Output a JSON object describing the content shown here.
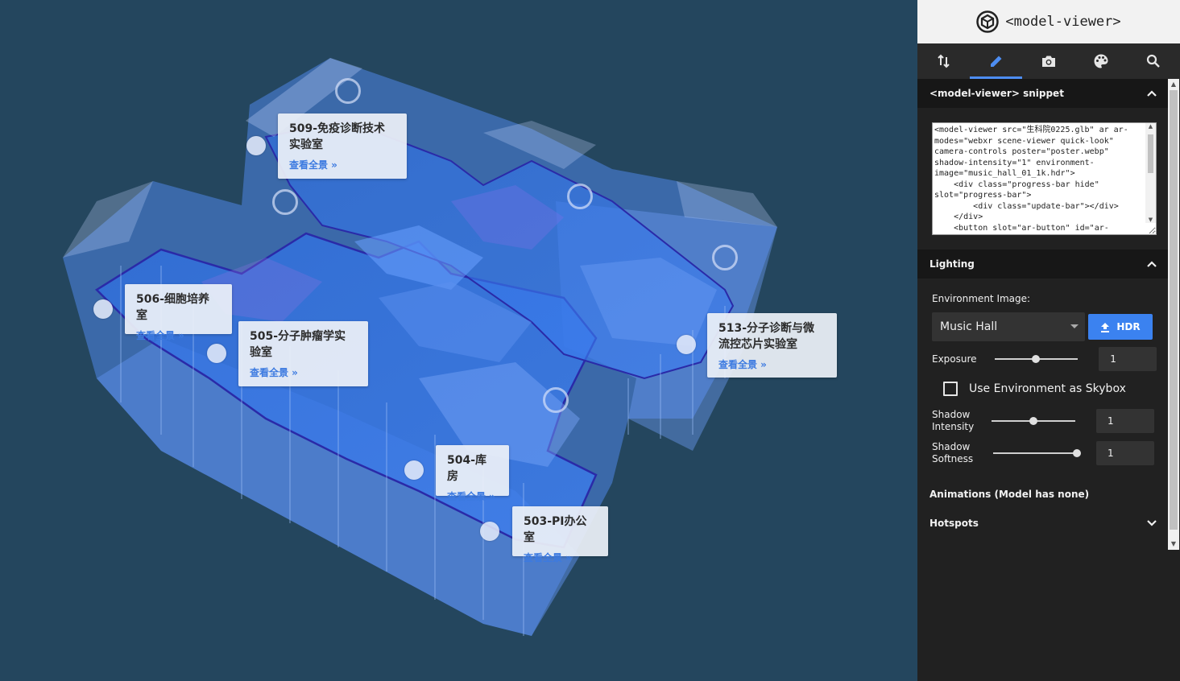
{
  "viewport": {
    "labels": [
      {
        "title": "509-免疫诊断技术\n实验室",
        "link": "查看全景 »"
      },
      {
        "title": "506-细胞培养室",
        "link": "查看全景 »"
      },
      {
        "title": "505-分子肿瘤学实\n验室",
        "link": "查看全景 »"
      },
      {
        "title": "513-分子诊断与微\n流控芯片实验室",
        "link": "查看全景 »"
      },
      {
        "title": "504-库房",
        "link": "查看全景 »"
      },
      {
        "title": "503-PI办公室",
        "link": "查看全景 »"
      }
    ]
  },
  "panel": {
    "brand": "<model-viewer>",
    "tabs": [
      {
        "name": "tab-transform",
        "icon": "swap-vertical-icon"
      },
      {
        "name": "tab-edit",
        "icon": "pencil-icon",
        "active": true
      },
      {
        "name": "tab-camera",
        "icon": "camera-icon"
      },
      {
        "name": "tab-materials",
        "icon": "palette-icon"
      },
      {
        "name": "tab-inspect",
        "icon": "search-icon"
      }
    ],
    "snippet": {
      "title": "<model-viewer> snippet",
      "code": "<model-viewer src=\"生科院0225.glb\" ar ar-modes=\"webxr scene-viewer quick-look\" camera-controls poster=\"poster.webp\" shadow-intensity=\"1\" environment-image=\"music_hall_01_1k.hdr\">\n    <div class=\"progress-bar hide\" slot=\"progress-bar\">\n        <div class=\"update-bar\"></div>\n    </div>\n    <button slot=\"ar-button\" id=\"ar-button\">\n        View in your space\n    </button>\n</model-viewer>"
    },
    "lighting": {
      "title": "Lighting",
      "env_label": "Environment Image:",
      "env_value": "Music Hall",
      "hdr_button": "HDR",
      "exposure_label": "Exposure",
      "exposure_value": "1",
      "exposure_fraction": 0.5,
      "skybox_label": "Use Environment as Skybox",
      "skybox_checked": false,
      "shadow_intensity_label": "Shadow\nIntensity",
      "shadow_intensity_value": "1",
      "shadow_intensity_fraction": 0.5,
      "shadow_softness_label": "Shadow\nSoftness",
      "shadow_softness_value": "1",
      "shadow_softness_fraction": 1.0
    },
    "animations": {
      "title": "Animations (Model has none)"
    },
    "hotspots": {
      "title": "Hotspots"
    }
  }
}
